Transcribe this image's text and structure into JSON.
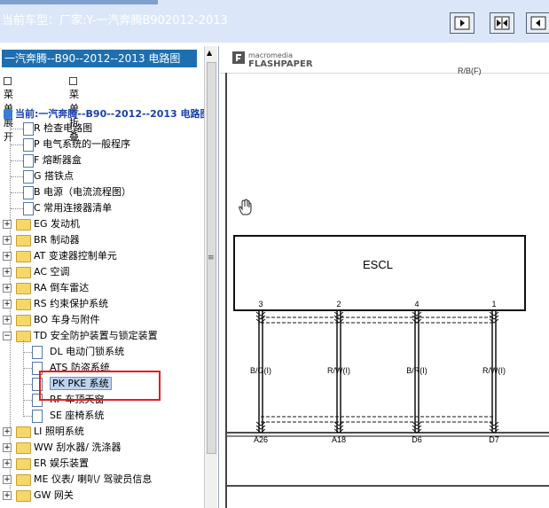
{
  "window": {
    "title": "当前车型：厂家:Y-一汽奔腾B902012-2013"
  },
  "toolbar": {
    "buttons": [
      {
        "name": "next-page-button",
        "icon": "arrow-right-icon"
      },
      {
        "name": "fit-width-button",
        "icon": "expand-arrows-icon"
      },
      {
        "name": "prev-page-button",
        "icon": "arrow-left-icon"
      }
    ]
  },
  "sidebar": {
    "header": "一汽奔腾--B90--2012--2013 电路图",
    "expand_label": "菜单展开",
    "collapse_label": "菜单折叠",
    "current": "当前:一汽奔腾--B90--2012--2013 电路图",
    "items": [
      {
        "type": "doc",
        "label": "R 检查电路图"
      },
      {
        "type": "doc",
        "label": "P 电气系统的一般程序"
      },
      {
        "type": "doc",
        "label": "F 熔断器盒"
      },
      {
        "type": "doc",
        "label": "G 搭铁点"
      },
      {
        "type": "doc",
        "label": "B 电源（电流流程图）"
      },
      {
        "type": "doc",
        "label": "C 常用连接器清单"
      },
      {
        "type": "folder",
        "label": "EG 发动机"
      },
      {
        "type": "folder",
        "label": "BR 制动器"
      },
      {
        "type": "folder",
        "label": "AT 变速器控制单元"
      },
      {
        "type": "folder",
        "label": "AC 空调"
      },
      {
        "type": "folder",
        "label": "RA 倒车雷达"
      },
      {
        "type": "folder",
        "label": "RS 约束保护系统"
      },
      {
        "type": "folder",
        "label": "BO 车身与附件"
      },
      {
        "type": "folder-open",
        "label": "TD 安全防护装置与锁定装置"
      },
      {
        "type": "subdoc",
        "label": "DL 电动门锁系统"
      },
      {
        "type": "subdoc",
        "label": "ATS 防盗系统"
      },
      {
        "type": "subdoc-selected",
        "label": "PK PKE 系统"
      },
      {
        "type": "subdoc",
        "label": "RF 车顶天窗"
      },
      {
        "type": "subdoc",
        "label": "SE 座椅系统"
      },
      {
        "type": "folder",
        "label": "LI 照明系统"
      },
      {
        "type": "folder",
        "label": "WW 刮水器/ 洗涤器"
      },
      {
        "type": "folder",
        "label": "ER 娱乐装置"
      },
      {
        "type": "folder",
        "label": "ME 仪表/ 喇叭/ 驾驶员信息"
      },
      {
        "type": "folder",
        "label": "GW 网关"
      }
    ]
  },
  "viewer": {
    "logo_top": "macromedia",
    "logo_bottom": "FLASHPAPER",
    "clipped_label": "R/B(F)",
    "component": "ESCL",
    "pins": [
      "3",
      "2",
      "4",
      "1"
    ],
    "wires": [
      "B/G(I)",
      "R/W(I)",
      "B/R(I)",
      "R/W(I)"
    ],
    "connectors": [
      "A26",
      "A18",
      "D6",
      "D7"
    ]
  }
}
